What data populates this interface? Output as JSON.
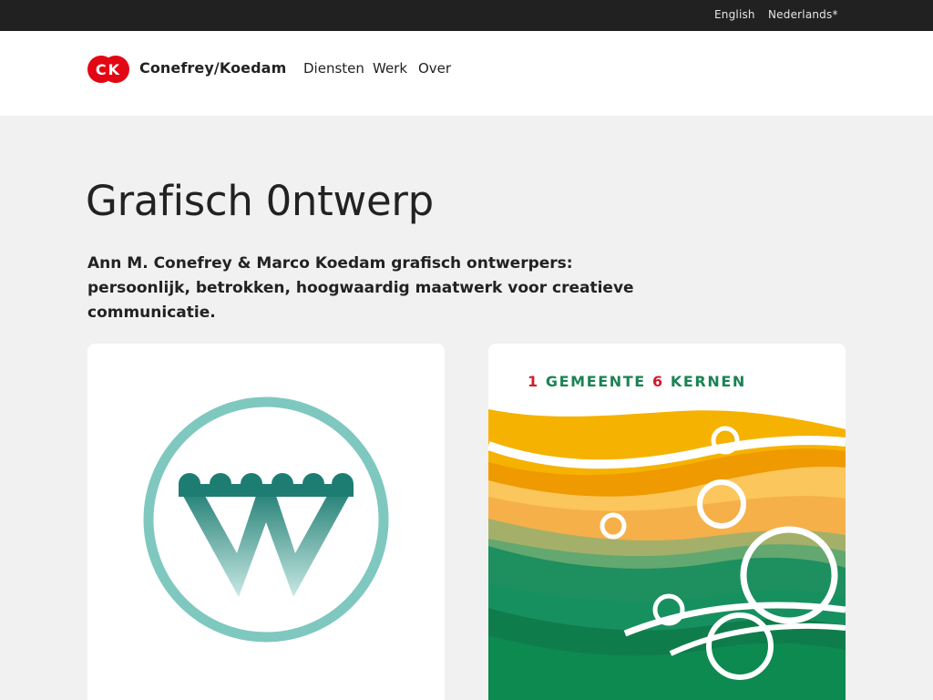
{
  "topbar": {
    "languages": [
      {
        "label": "English"
      },
      {
        "label": "Nederlands*"
      }
    ]
  },
  "header": {
    "logo_text": "CK",
    "brand": "Conefrey/Koedam",
    "nav": [
      {
        "label": "Diensten"
      },
      {
        "label": "Werk"
      },
      {
        "label": "Over"
      }
    ]
  },
  "main": {
    "title": "Grafisch 0ntwerp",
    "intro": "Ann M. Conefrey & Marco Koedam grafisch ontwerpers: persoonlijk, betrokken, hoogwaardig maatwerk voor creatieve communicatie.",
    "cards": [
      {
        "icon": "w-logo-icon",
        "colors": {
          "teal": "#7fc8c0",
          "dark_teal": "#1e7d72"
        }
      },
      {
        "headline": {
          "part1": "1",
          "part2": "GEMEENTE",
          "part3": "6",
          "part4": "KERNEN"
        },
        "colors": {
          "red": "#d21b2e",
          "green": "#1a8354",
          "orange": "#f2a200"
        }
      }
    ]
  },
  "colors": {
    "topbar": "#212121",
    "header_bg": "#ffffff",
    "page_bg": "#f1f1f1",
    "logo_red": "#e30613"
  }
}
